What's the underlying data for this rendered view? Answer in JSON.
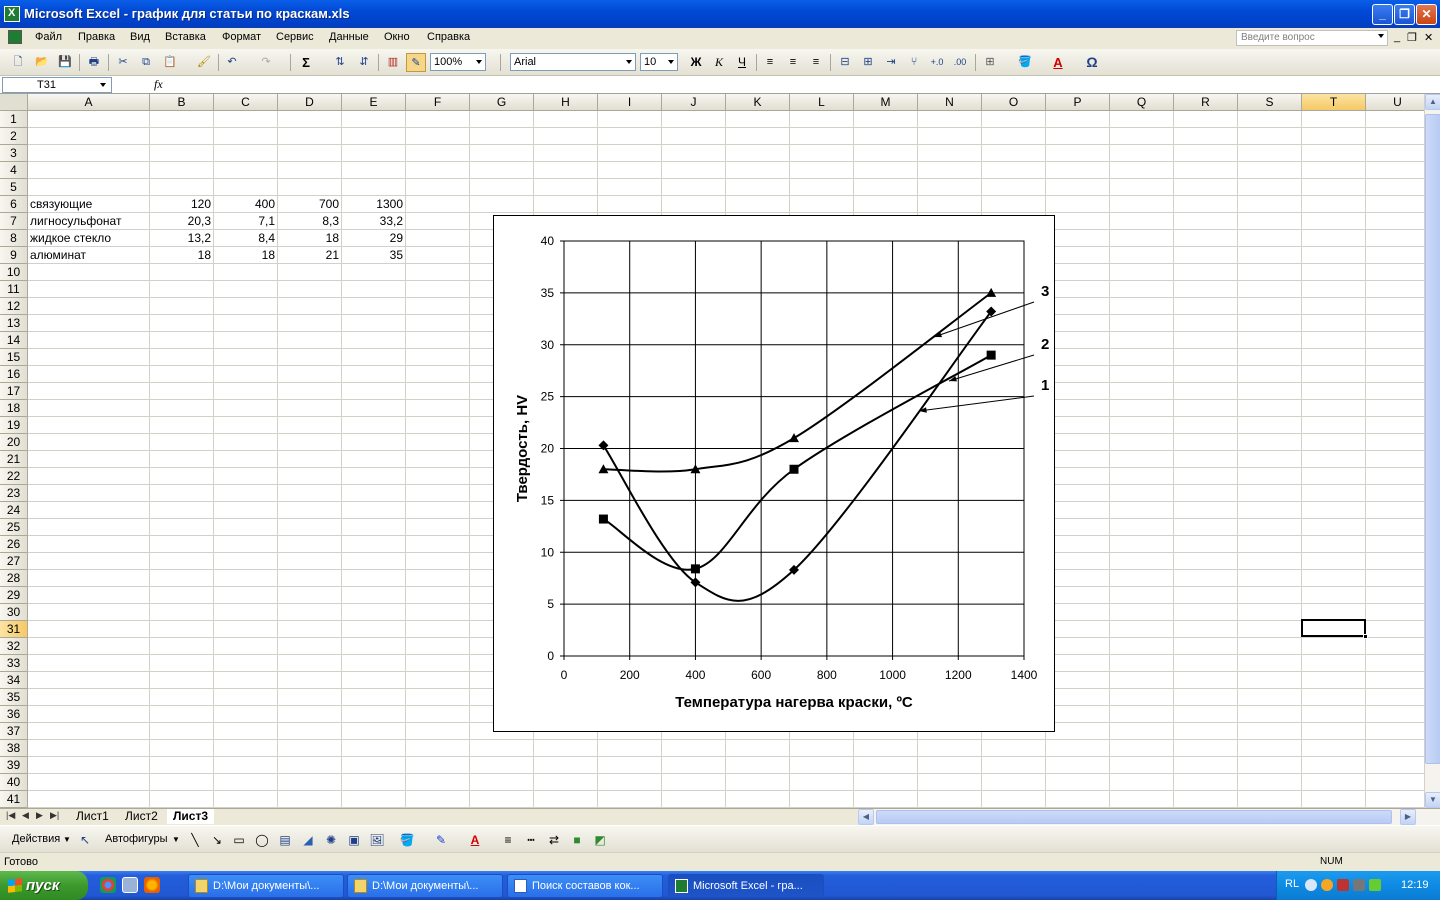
{
  "window": {
    "title": "Microsoft Excel - график для статьи по краскам.xls"
  },
  "menu": [
    "Файл",
    "Правка",
    "Вид",
    "Вставка",
    "Формат",
    "Сервис",
    "Данные",
    "Окно",
    "Справка"
  ],
  "help_placeholder": "Введите вопрос",
  "toolbar": {
    "zoom": "100%",
    "font": "Arial",
    "size": "10",
    "bold": "Ж",
    "italic": "К",
    "underline": "Ч"
  },
  "namebox": "T31",
  "fx": "fx",
  "columns": [
    "A",
    "B",
    "C",
    "D",
    "E",
    "F",
    "G",
    "H",
    "I",
    "J",
    "K",
    "L",
    "M",
    "N",
    "O",
    "P",
    "Q",
    "R",
    "S",
    "T",
    "U"
  ],
  "selected_column": "T",
  "selected_row": 31,
  "rows_visible": 41,
  "cells": [
    {
      "row": 6,
      "A": "связующие",
      "B": "120",
      "C": "400",
      "D": "700",
      "E": "1300"
    },
    {
      "row": 7,
      "A": "лигносульфонат",
      "B": "20,3",
      "C": "7,1",
      "D": "8,3",
      "E": "33,2"
    },
    {
      "row": 8,
      "A": "жидкое стекло",
      "B": "13,2",
      "C": "8,4",
      "D": "18",
      "E": "29"
    },
    {
      "row": 9,
      "A": "алюминат",
      "B": "18",
      "C": "18",
      "D": "21",
      "E": "35"
    }
  ],
  "chart_data": {
    "type": "line",
    "xlabel": "Температура нагерва краски, ºС",
    "ylabel": "Твердость, HV",
    "xlim": [
      0,
      1400
    ],
    "ylim": [
      0,
      40
    ],
    "xticks": [
      0,
      200,
      400,
      600,
      800,
      1000,
      1200,
      1400
    ],
    "yticks": [
      0,
      5,
      10,
      15,
      20,
      25,
      30,
      35,
      40
    ],
    "grid": true,
    "x": [
      120,
      400,
      700,
      1300
    ],
    "series": [
      {
        "name": "1",
        "marker": "diamond",
        "values": [
          20.3,
          7.1,
          8.3,
          33.2
        ]
      },
      {
        "name": "2",
        "marker": "square",
        "values": [
          13.2,
          8.4,
          18,
          29
        ]
      },
      {
        "name": "3",
        "marker": "triangle",
        "values": [
          18,
          18,
          21,
          35
        ]
      }
    ]
  },
  "tabs": [
    "Лист1",
    "Лист2",
    "Лист3"
  ],
  "active_tab": "Лист3",
  "drawing": {
    "actions": "Действия",
    "autoshapes": "Автофигуры"
  },
  "status": {
    "ready": "Готово",
    "num": "NUM"
  },
  "taskbar": {
    "start": "пуск",
    "tasks": [
      "D:\\Мои документы\\...",
      "D:\\Мои документы\\...",
      "Поиск составов кок...",
      "Microsoft Excel - гра..."
    ],
    "lang": "RL",
    "clock": "12:19"
  }
}
